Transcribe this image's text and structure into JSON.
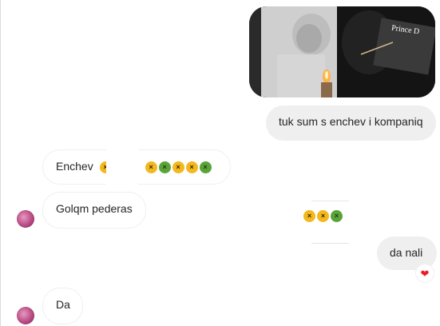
{
  "messages": {
    "m1_text": "tuk sum s enchev i kompaniq",
    "m2_text": "Enchev",
    "m3_text": "Golqm pederas",
    "m4_text": "da nali",
    "m5_text": "Da"
  },
  "media": {
    "caption_on_image": "Prince D"
  },
  "reaction": {
    "emoji": "❤"
  },
  "colors": {
    "outgoing_bubble": "#efefef",
    "incoming_border": "#efefef",
    "heart": "#ed1c24",
    "avatar": "#b94a83"
  },
  "icons": {
    "sick_face": "nauseated-face-icon",
    "heart": "heart-icon"
  }
}
